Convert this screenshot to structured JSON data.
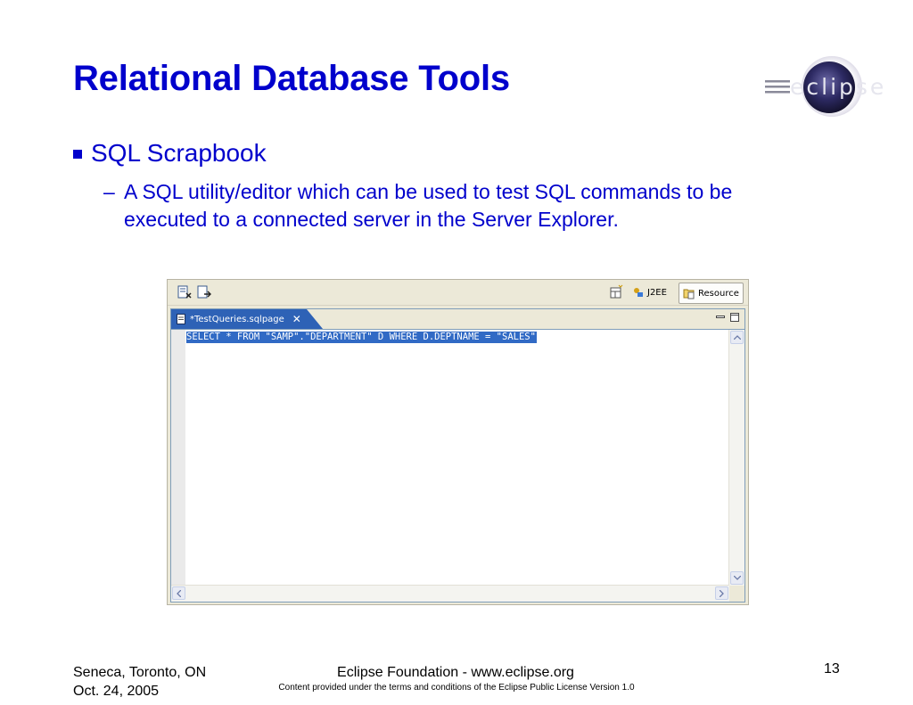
{
  "slide": {
    "title": "Relational Database Tools",
    "logo_text": "eclipse",
    "bullet": "SQL Scrapbook",
    "sub_dash": "–",
    "sub_text": "A SQL utility/editor which can be used to test SQL commands to be executed to a connected server in the Server Explorer."
  },
  "eclipse_window": {
    "perspectives": [
      {
        "label": "J2EE",
        "active": false,
        "icon": "j2ee-perspective-icon"
      },
      {
        "label": "Resource",
        "active": true,
        "icon": "resource-perspective-icon"
      }
    ],
    "editor_tab": {
      "label": "*TestQueries.sqlpage",
      "close_glyph": "✕"
    },
    "code_line": "SELECT * FROM \"SAMP\".\"DEPARTMENT\" D WHERE D.DEPTNAME = \"SALES\""
  },
  "footer": {
    "location": "Seneca, Toronto, ON",
    "date": "Oct. 24, 2005",
    "center_title": "Eclipse Foundation - www.eclipse.org",
    "license": "Content provided under the terms and conditions of the Eclipse Public License Version 1.0",
    "page_number": "13"
  },
  "colors": {
    "title_blue": "#0000cc",
    "selection_blue": "#316ac5",
    "tab_blue": "#2e62b6"
  }
}
